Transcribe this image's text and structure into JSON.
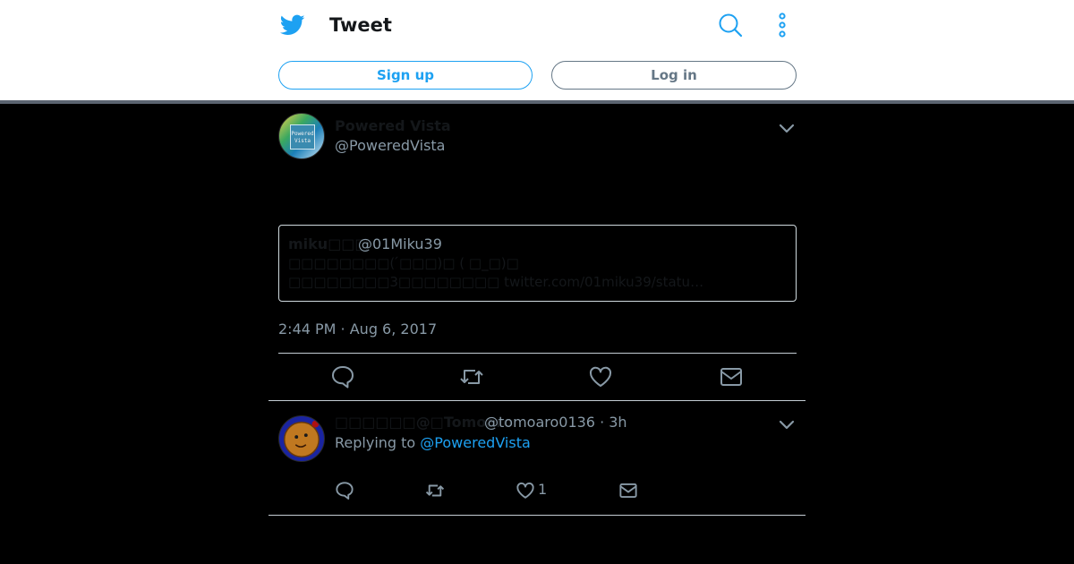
{
  "header": {
    "title": "Tweet",
    "signup_label": "Sign up",
    "login_label": "Log in",
    "accent_color": "#1da1f2"
  },
  "tweet": {
    "author_name": "Powered Vista",
    "author_handle": "@PoweredVista",
    "avatar_text": "Powered Vista",
    "timestamp": "2:44 PM · Aug 6, 2017",
    "quoted": {
      "name": "miku□□□",
      "handle": "@01Miku39",
      "line1": "□□□□□□□□( ́□□□)□ ( □_□)□",
      "line2_text": "□□□□□□□□3□□□□□□□□",
      "line2_link": "twitter.com/01miku39/statu…"
    },
    "actions": [
      "reply-icon",
      "retweet-icon",
      "like-icon",
      "message-icon"
    ]
  },
  "reply": {
    "author_name": "□□□□□□@□Tomoaro",
    "author_handle": "@tomoaro0136 · 3h",
    "replying_to_label": "Replying to",
    "replying_to_handle": "@PoweredVista",
    "like_count": "1"
  }
}
